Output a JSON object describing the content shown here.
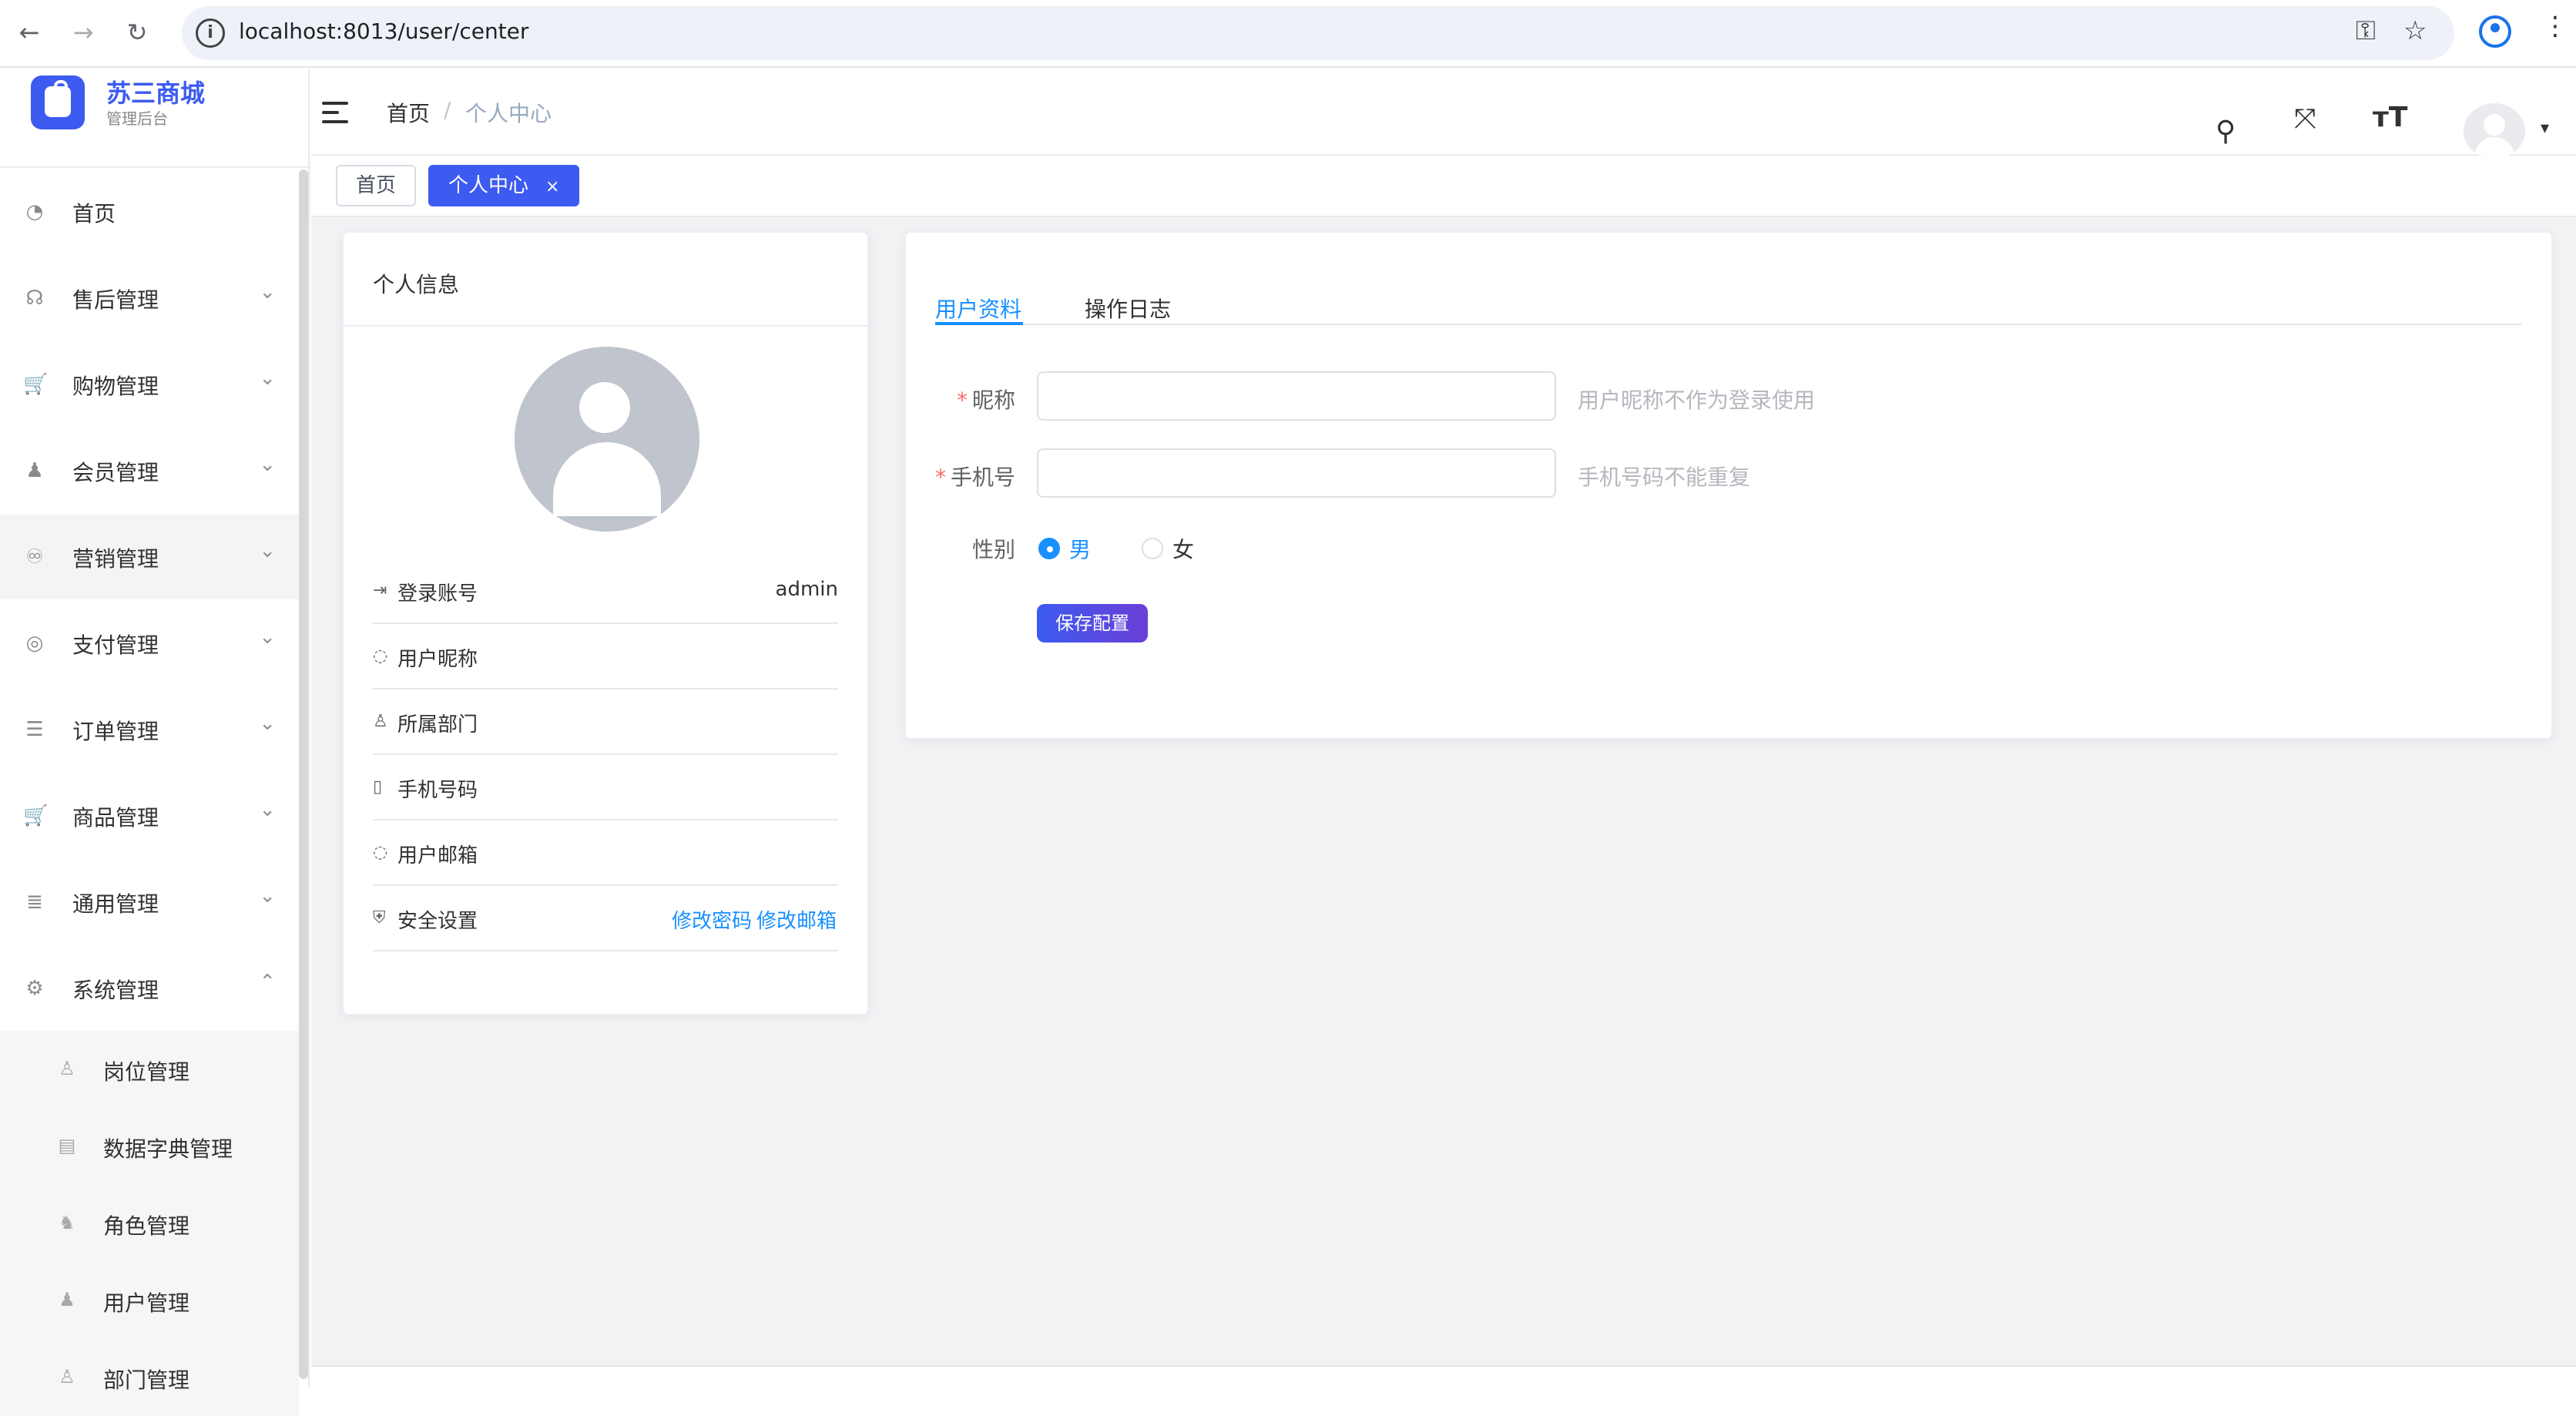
{
  "browser": {
    "url": "localhost:8013/user/center",
    "back_glyph": "←",
    "forward_glyph": "→",
    "reload_glyph": "↻",
    "key_glyph": "⚿",
    "star_glyph": "☆",
    "more_glyph": "⋮"
  },
  "brand": {
    "title": "苏三商城",
    "subtitle": "管理后台",
    "color": "#3d5bf0"
  },
  "sidebar": {
    "menu": [
      {
        "label": "首页",
        "icon": "dashboard-icon",
        "glyph": "◔",
        "chevron": ""
      },
      {
        "label": "售后管理",
        "icon": "headset-icon",
        "glyph": "☊",
        "chevron": "⌄"
      },
      {
        "label": "购物管理",
        "icon": "cart-icon",
        "glyph": "🛒",
        "chevron": "⌄"
      },
      {
        "label": "会员管理",
        "icon": "member-icon",
        "glyph": "♟",
        "chevron": "⌄"
      },
      {
        "label": "营销管理",
        "icon": "marketing-icon",
        "glyph": "♾",
        "chevron": "⌄"
      },
      {
        "label": "支付管理",
        "icon": "payment-icon",
        "glyph": "◎",
        "chevron": "⌄"
      },
      {
        "label": "订单管理",
        "icon": "list-icon",
        "glyph": "☰",
        "chevron": "⌄"
      },
      {
        "label": "商品管理",
        "icon": "cart-icon",
        "glyph": "🛒",
        "chevron": "⌄"
      },
      {
        "label": "通用管理",
        "icon": "database-icon",
        "glyph": "≣",
        "chevron": "⌄"
      },
      {
        "label": "系统管理",
        "icon": "gear-icon",
        "glyph": "⚙",
        "chevron": "⌃"
      }
    ],
    "submenu": [
      {
        "label": "岗位管理",
        "icon": "post-icon",
        "glyph": "♙"
      },
      {
        "label": "数据字典管理",
        "icon": "dictionary-icon",
        "glyph": "▤"
      },
      {
        "label": "角色管理",
        "icon": "role-icon",
        "glyph": "♞"
      },
      {
        "label": "用户管理",
        "icon": "user-icon",
        "glyph": "♟"
      },
      {
        "label": "部门管理",
        "icon": "department-icon",
        "glyph": "♙"
      }
    ]
  },
  "header": {
    "breadcrumb_home": "首页",
    "breadcrumb_sep": "/",
    "breadcrumb_current": "个人中心",
    "search_glyph": "⚲",
    "fullscreen_glyph": "⤧",
    "fontsize_glyph": "ᴛT",
    "caret_glyph": "▾"
  },
  "tags": {
    "home": "首页",
    "current": "个人中心",
    "close_glyph": "×"
  },
  "profile_card": {
    "title": "个人信息",
    "rows": [
      {
        "label": "登录账号",
        "value": "admin",
        "icon": "login-icon",
        "glyph": "⇥"
      },
      {
        "label": "用户昵称",
        "value": "",
        "icon": "nickname-icon",
        "glyph": "◌"
      },
      {
        "label": "所属部门",
        "value": "",
        "icon": "department-icon",
        "glyph": "♙"
      },
      {
        "label": "手机号码",
        "value": "",
        "icon": "phone-icon",
        "glyph": "▯"
      },
      {
        "label": "用户邮箱",
        "value": "",
        "icon": "email-icon",
        "glyph": "◌"
      },
      {
        "label": "安全设置",
        "value": "",
        "icon": "shield-icon",
        "glyph": "⛨"
      }
    ],
    "change_password": "修改密码",
    "change_email": "修改邮箱"
  },
  "form_card": {
    "tabs": [
      "用户资料",
      "操作日志"
    ],
    "active_tab": 0,
    "nickname_label": "昵称",
    "nickname_value": "",
    "nickname_hint": "用户昵称不作为登录使用",
    "phone_label": "手机号",
    "phone_value": "",
    "phone_hint": "手机号码不能重复",
    "gender_label": "性别",
    "gender_options": [
      "男",
      "女"
    ],
    "gender_selected": "男",
    "required_mark": "*",
    "save_label": "保存配置"
  },
  "colors": {
    "accent": "#1890ff",
    "primary": "#3d5bf0",
    "required": "#f56c6c",
    "hint": "#b4b7bd"
  }
}
